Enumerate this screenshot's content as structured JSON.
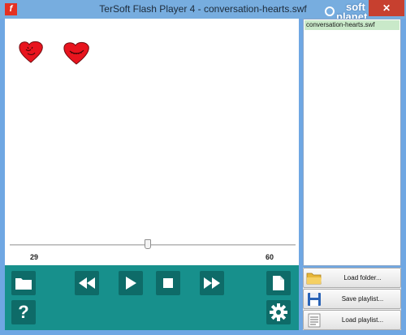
{
  "window": {
    "title": "TerSoft Flash Player 4 - conversation-hearts.swf",
    "close_glyph": "✕",
    "icon_letter": "f"
  },
  "watermark": {
    "line1": "soft",
    "line2": "planet"
  },
  "seek": {
    "position": 29,
    "length": 60,
    "position_label": "29",
    "length_label": "60"
  },
  "controls": {
    "buttons": [
      {
        "name": "open-folder",
        "icon": "folder-icon"
      },
      {
        "name": "rewind",
        "icon": "rewind-icon"
      },
      {
        "name": "play",
        "icon": "play-icon"
      },
      {
        "name": "stop",
        "icon": "stop-icon"
      },
      {
        "name": "fast-forward",
        "icon": "fast-forward-icon"
      },
      {
        "name": "open-file",
        "icon": "document-icon"
      },
      {
        "name": "help",
        "icon": "question-icon"
      },
      {
        "name": "settings",
        "icon": "gear-icon"
      }
    ],
    "help_glyph": "?"
  },
  "playlist": {
    "items": [
      "conversation-hearts.swf"
    ]
  },
  "side_buttons": {
    "load_folder": "Load folder...",
    "save_playlist": "Save playlist...",
    "load_playlist": "Load playlist..."
  },
  "colors": {
    "accent": "#17908c",
    "button_dark": "#0e6b68",
    "heart": "#e8141e",
    "selected_item": "#c9e9c9"
  }
}
